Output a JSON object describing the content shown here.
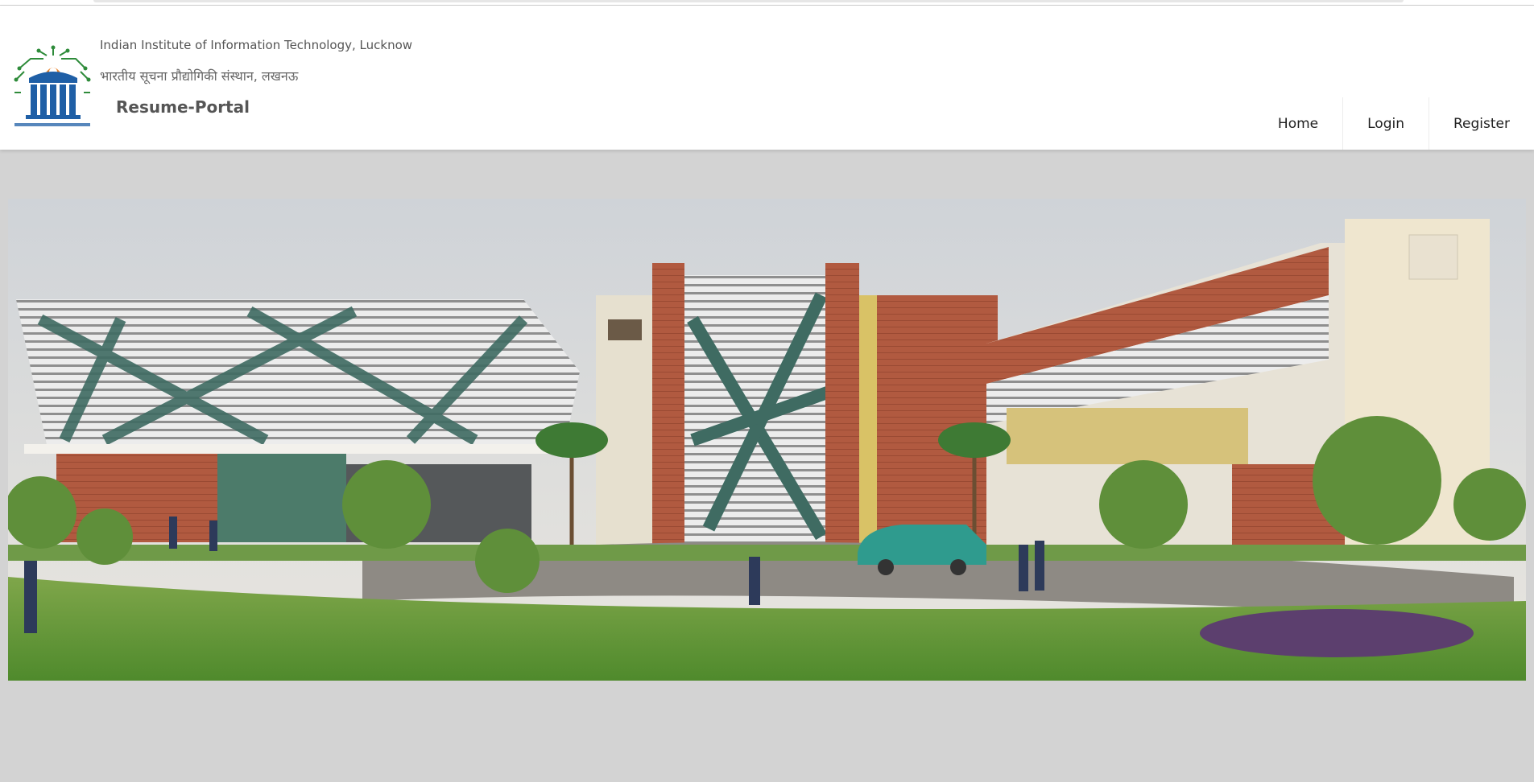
{
  "header": {
    "institute_name_en": "Indian Institute of Information Technology, Lucknow",
    "institute_name_hi": "भारतीय सूचना प्रौद्योगिकी संस्थान, लखनऊ",
    "portal_name": "Resume-Portal",
    "logo_icon": "iiitl-logo-icon"
  },
  "nav": {
    "items": [
      {
        "label": "Home"
      },
      {
        "label": "Login"
      },
      {
        "label": "Register"
      }
    ]
  },
  "hero": {
    "image": "campus-building-illustration"
  },
  "colors": {
    "page_bg": "#d3d3d3",
    "header_bg": "#ffffff",
    "logo_blue": "#1f5fa6",
    "logo_green": "#2e8b3a",
    "text_gray": "#555555"
  }
}
